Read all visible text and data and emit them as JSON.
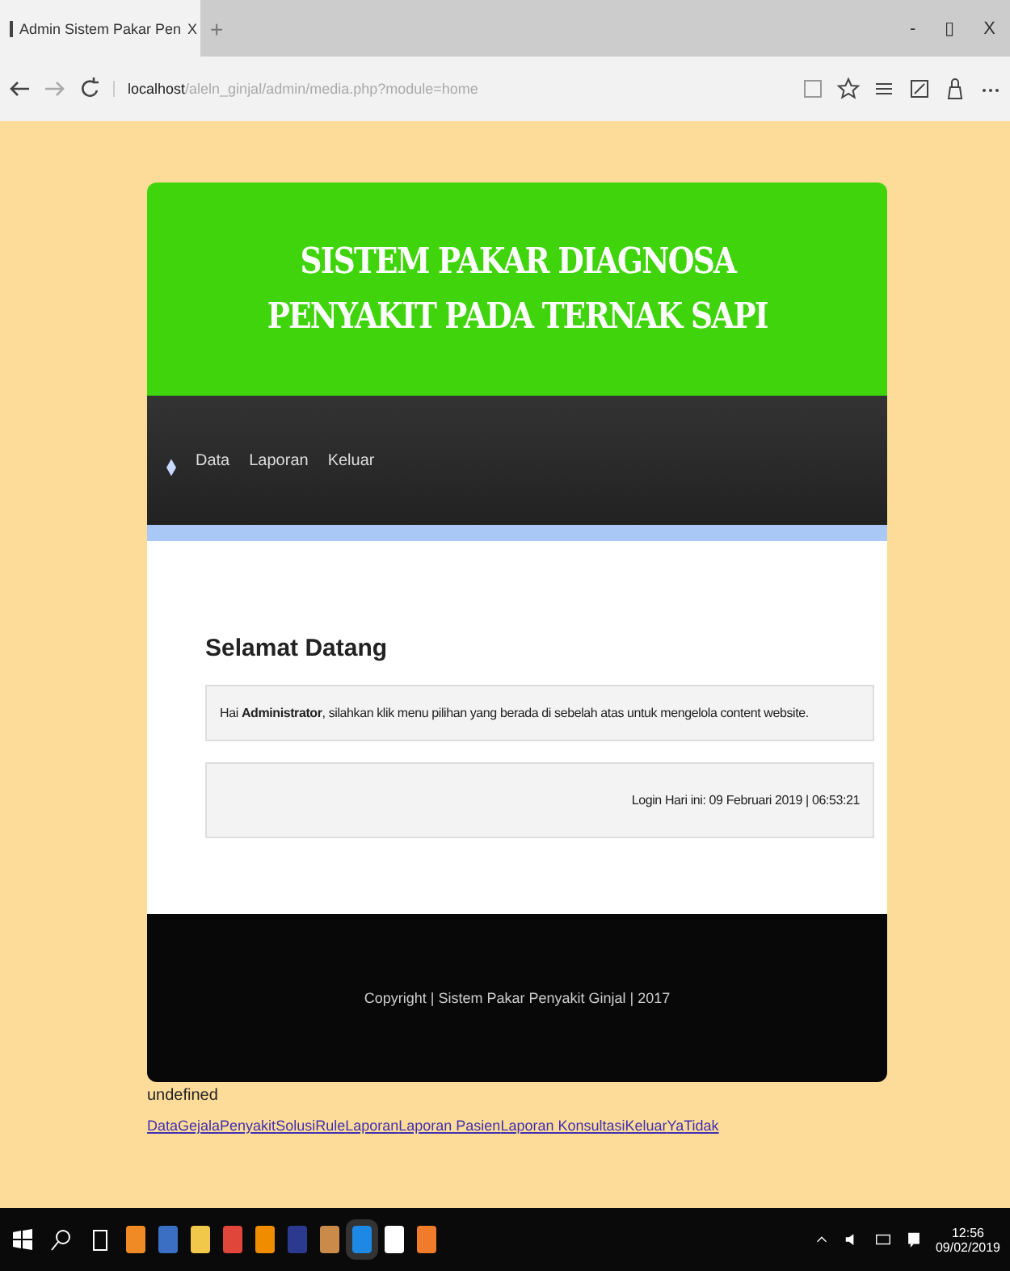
{
  "browser": {
    "tab_title": "Admin Sistem Pakar Pen",
    "tab_close": "X",
    "new_tab": "+",
    "window_controls": [
      "-",
      "▯",
      "X"
    ],
    "address_host": "localhost",
    "address_path": "/aleln_ginjal/admin/media.php?module=home"
  },
  "header": {
    "title_lines": [
      "SISTEM PAKAR DIAGNOSA",
      "PENYAKIT PADA TERNAK SAPI"
    ]
  },
  "nav": {
    "items": [
      "Data",
      "Laporan",
      "Keluar"
    ]
  },
  "content": {
    "heading": "Selamat Datang",
    "greeting": "Hai **Administrator**, silahkan klik menu pilihan yang berada di sebelah atas untuk mengelola content website.",
    "login_info": "Login Hari ini: 09 Februari 2019 | 06:53:21"
  },
  "footer": {
    "text": "Copyright | Sistem Pakar Penyakit Ginjal | 2017"
  },
  "below": {
    "text": "undefined",
    "links": [
      "Data",
      "Gejala",
      "Penyakit",
      "Solusi",
      "Rule",
      "Laporan",
      "Laporan Pasien",
      "Laporan Konsultasi",
      "Keluar",
      "Ya",
      "Tidak"
    ]
  },
  "taskbar": {
    "apps": [
      {
        "color": "#f08a24"
      },
      {
        "color": "#3a6fc4"
      },
      {
        "color": "#f2c84b"
      },
      {
        "color": "#e0463a"
      },
      {
        "color": "#f08c00"
      },
      {
        "color": "#2b3a8f"
      },
      {
        "color": "#c98a4a"
      },
      {
        "color": "#1e88e5"
      },
      {
        "color": "#ffffff"
      },
      {
        "color": "#f07b2a"
      }
    ],
    "time": "12:56",
    "date": "09/02/2019"
  }
}
